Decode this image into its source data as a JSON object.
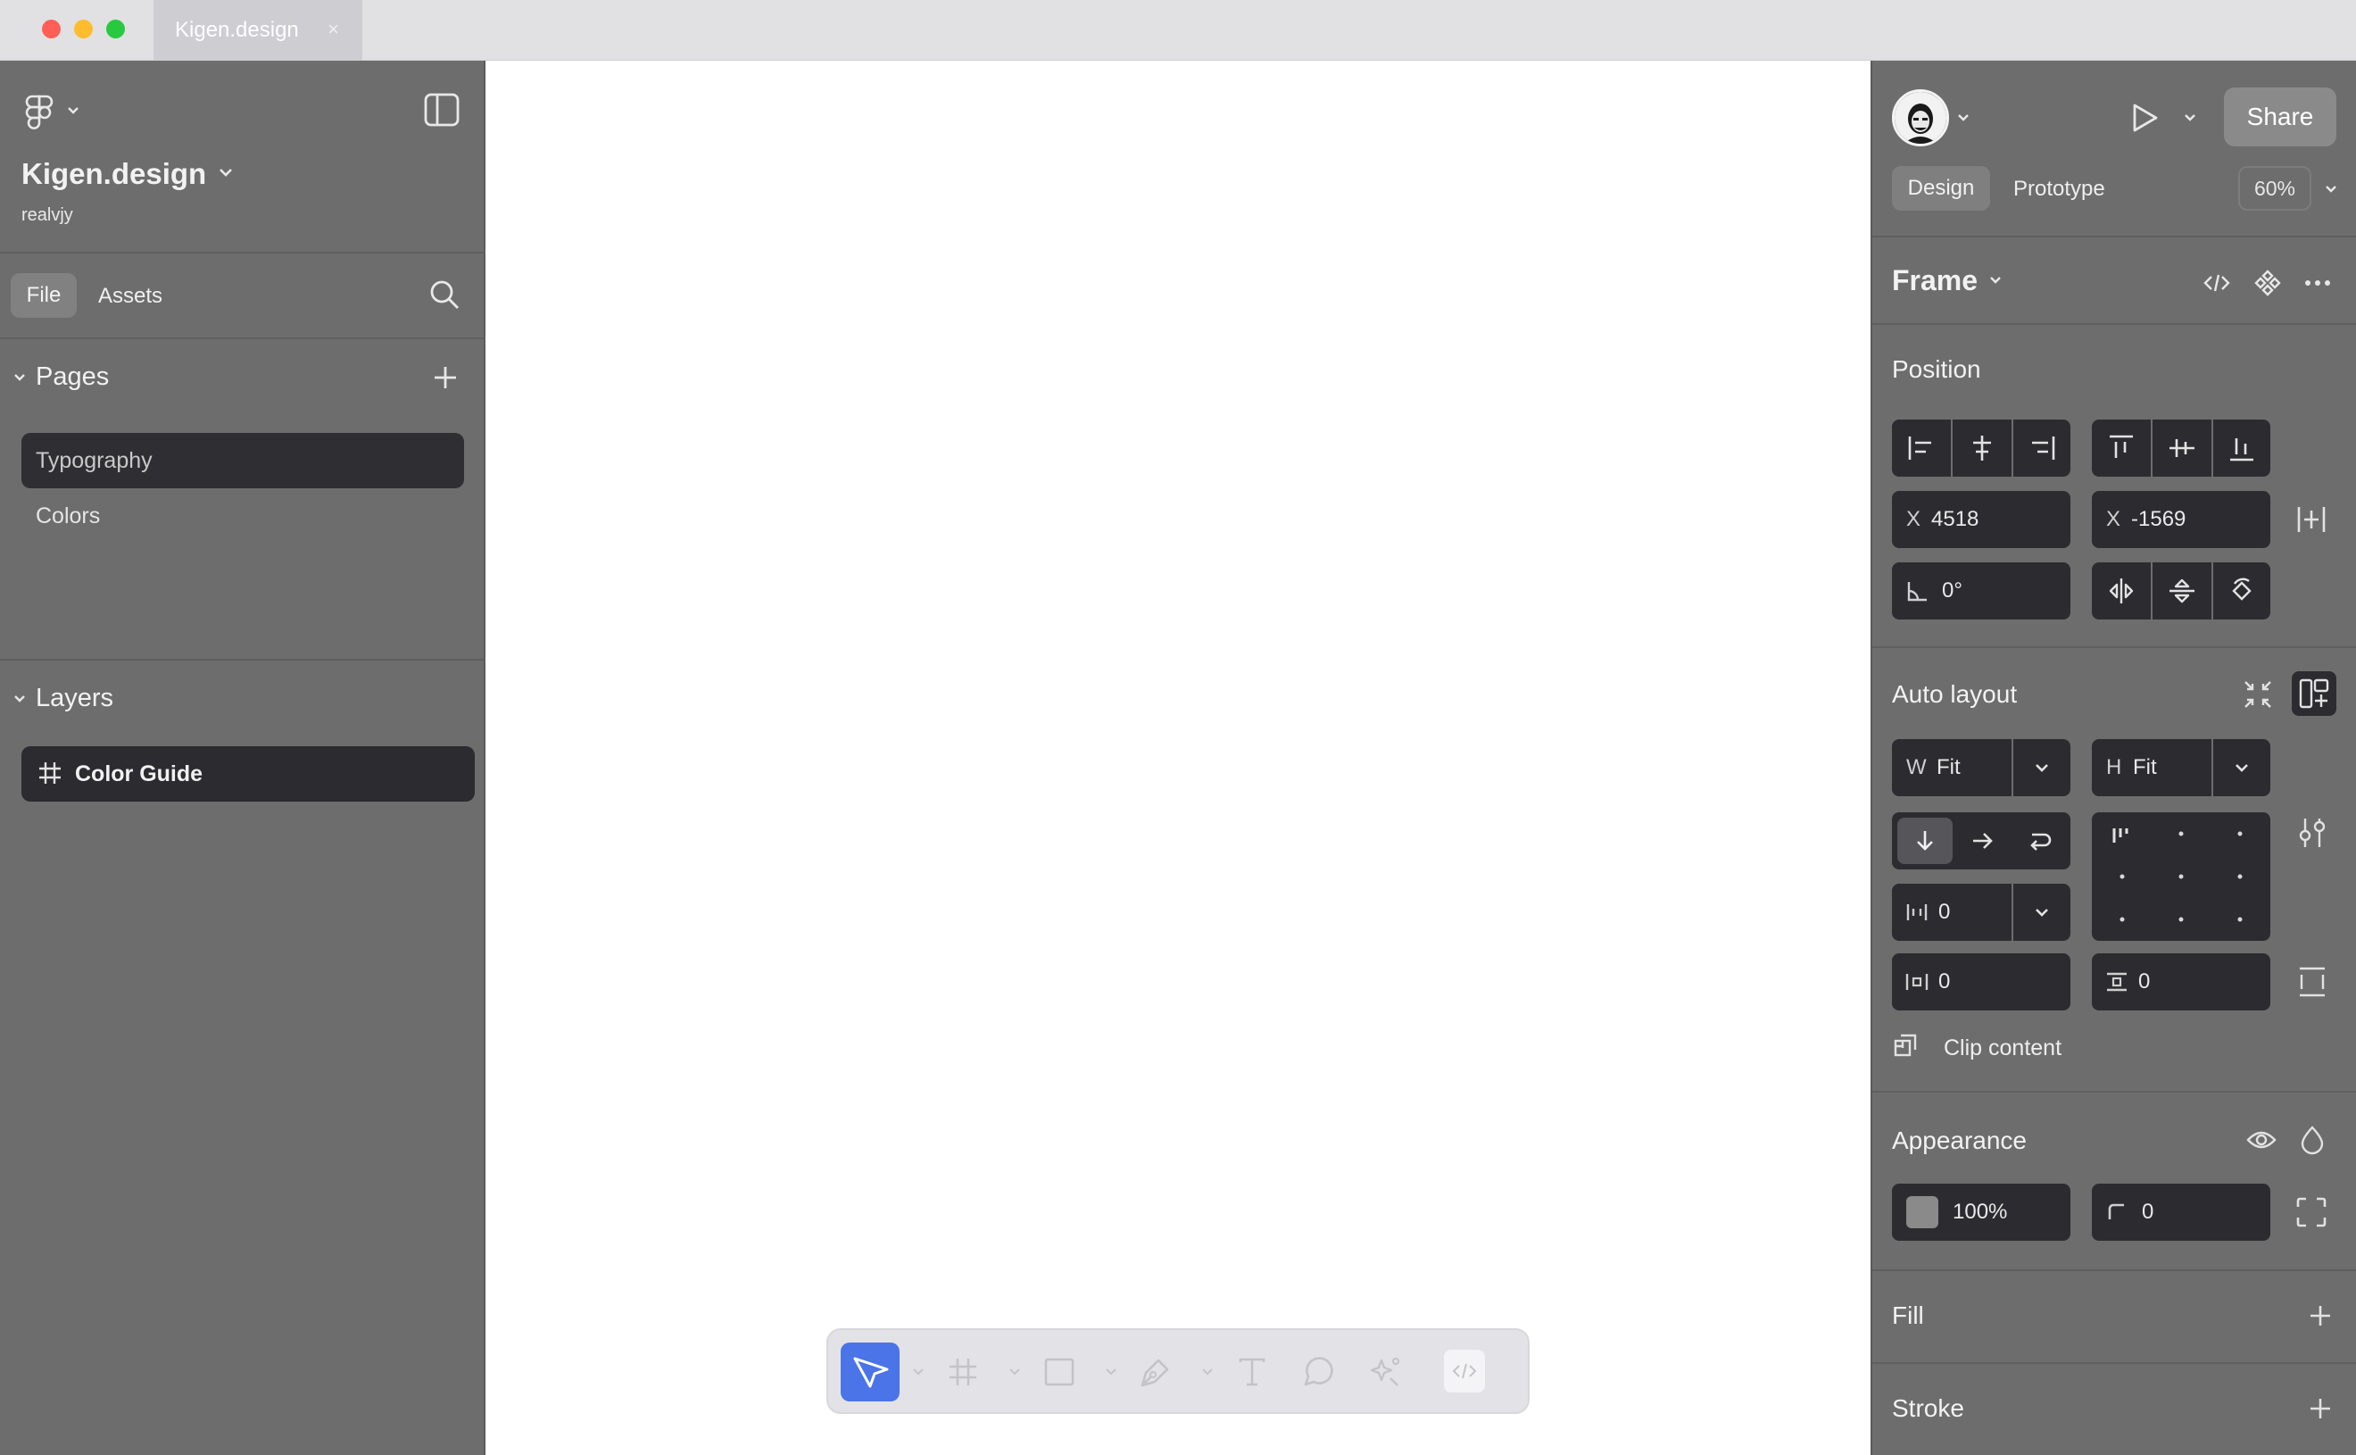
{
  "window": {
    "tab_title": "Kigen.design",
    "tab_close": "×"
  },
  "left_panel": {
    "file_name": "Kigen.design",
    "owner": "realvjy",
    "tabs": {
      "file": "File",
      "assets": "Assets"
    },
    "pages": {
      "title": "Pages",
      "items": [
        {
          "label": "Typography",
          "selected": true
        },
        {
          "label": "Colors",
          "selected": false
        }
      ]
    },
    "layers": {
      "title": "Layers",
      "items": [
        {
          "label": "Color Guide",
          "icon": "frame-hash-icon",
          "selected": true
        }
      ]
    }
  },
  "right_panel": {
    "share_label": "Share",
    "tabs": {
      "design": "Design",
      "prototype": "Prototype"
    },
    "zoom": "60%",
    "frame_title": "Frame",
    "position": {
      "title": "Position",
      "x_label": "X",
      "x_value": "4518",
      "y_label": "X",
      "y_value": "-1569",
      "rotation": "0°"
    },
    "auto_layout": {
      "title": "Auto layout",
      "w_label": "W",
      "w_value": "Fit",
      "h_label": "H",
      "h_value": "Fit",
      "gap": "0",
      "padding_h": "0",
      "padding_v": "0",
      "clip_content": "Clip content"
    },
    "appearance": {
      "title": "Appearance",
      "opacity": "100%",
      "radius": "0"
    },
    "fill": {
      "title": "Fill"
    },
    "stroke": {
      "title": "Stroke"
    }
  },
  "colors": {
    "panel_bg": "#6d6d6d",
    "input_bg": "#2c2c30",
    "accent": "#4a74e8",
    "canvas_bg": "#ffffff"
  }
}
